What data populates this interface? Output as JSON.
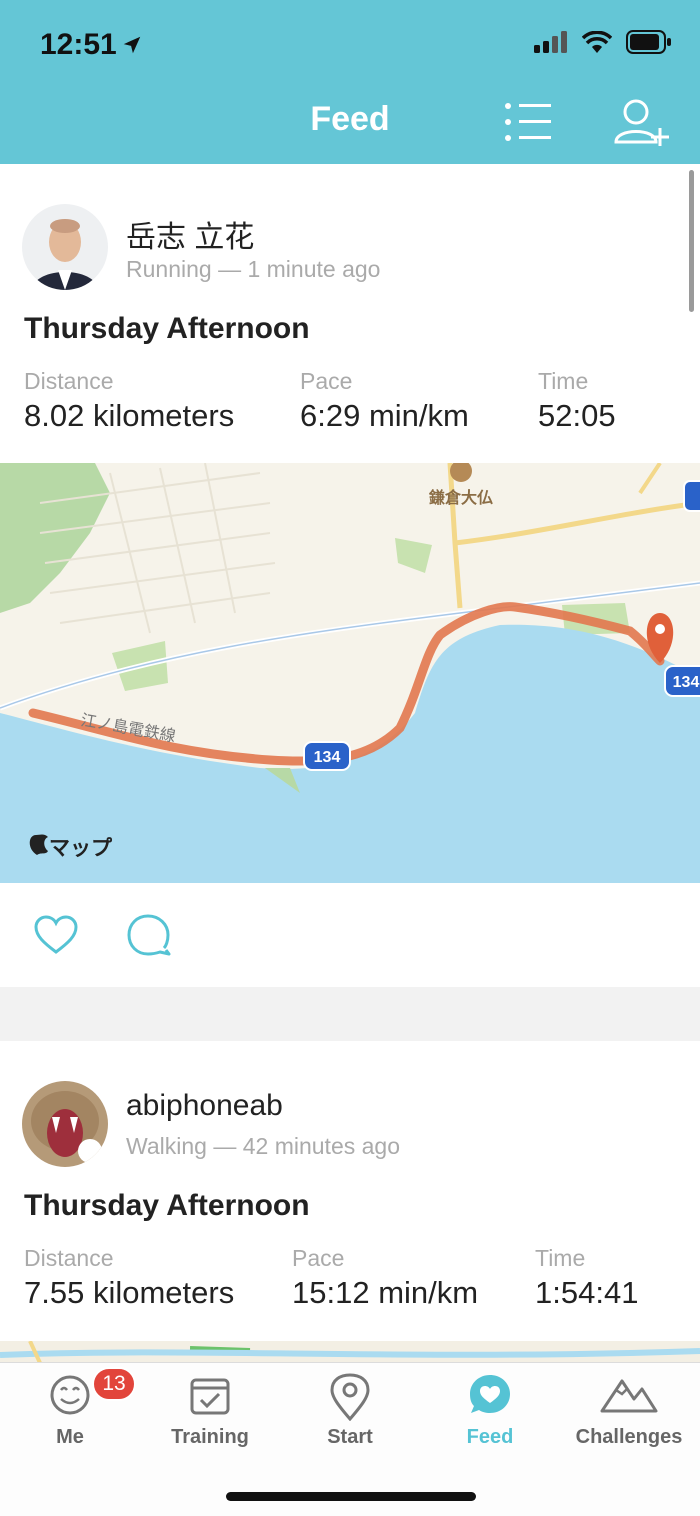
{
  "status_bar": {
    "time": "12:51"
  },
  "header": {
    "title": "Feed"
  },
  "feed": [
    {
      "user": "岳志 立花",
      "subline": "Running — 1 minute ago",
      "title": "Thursday Afternoon",
      "stats": [
        {
          "label": "Distance",
          "value": "8.02 kilometers"
        },
        {
          "label": "Pace",
          "value": "6:29 min/km"
        },
        {
          "label": "Time",
          "value": "52:05"
        }
      ],
      "map": {
        "landmark": "鎌倉大仏",
        "railway": "江ノ島電鉄線",
        "route_shield": "134",
        "attribution": "マップ"
      }
    },
    {
      "user": "abiphoneab",
      "subline": "Walking — 42 minutes ago",
      "title": "Thursday Afternoon",
      "stats": [
        {
          "label": "Distance",
          "value": "7.55 kilometers"
        },
        {
          "label": "Pace",
          "value": "15:12 min/km"
        },
        {
          "label": "Time",
          "value": "1:54:41"
        }
      ]
    }
  ],
  "tabs": [
    {
      "label": "Me",
      "icon": "smiley-icon",
      "badge": "13"
    },
    {
      "label": "Training",
      "icon": "checklist-icon"
    },
    {
      "label": "Start",
      "icon": "location-pin-icon"
    },
    {
      "label": "Feed",
      "icon": "heart-bubble-icon",
      "active": true
    },
    {
      "label": "Challenges",
      "icon": "mountain-icon"
    }
  ],
  "colors": {
    "header": "#64c6d6",
    "accent": "#55c3d4",
    "route": "#e2784f",
    "badge": "#e2453b",
    "water": "#aadbf0",
    "land": "#f6f3ea"
  }
}
